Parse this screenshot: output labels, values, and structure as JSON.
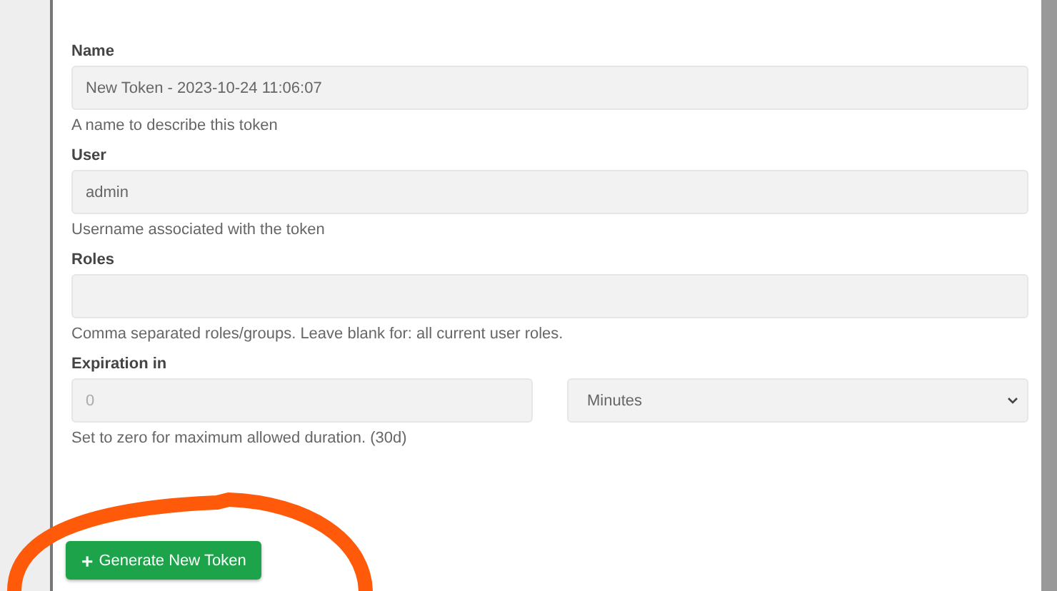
{
  "fields": [
    {
      "kind": "input",
      "label": "Name",
      "value": "New Token - 2023-10-24 11:06:07",
      "help": "A name to describe this token"
    },
    {
      "kind": "input",
      "label": "User",
      "value": "admin",
      "help": "Username associated with the token"
    },
    {
      "kind": "input",
      "label": "Roles",
      "help": "Comma separated roles/groups. Leave blank for: all current user roles."
    },
    {
      "kind": "split",
      "label": "Expiration in",
      "placeholder": "0",
      "select": "Minutes",
      "help": "Set to zero for maximum allowed duration. (30d)"
    }
  ],
  "button": {
    "icon": "+",
    "label": "Generate New Token"
  },
  "annotation": {
    "kind": "circle",
    "color": "#ff5a0a"
  }
}
